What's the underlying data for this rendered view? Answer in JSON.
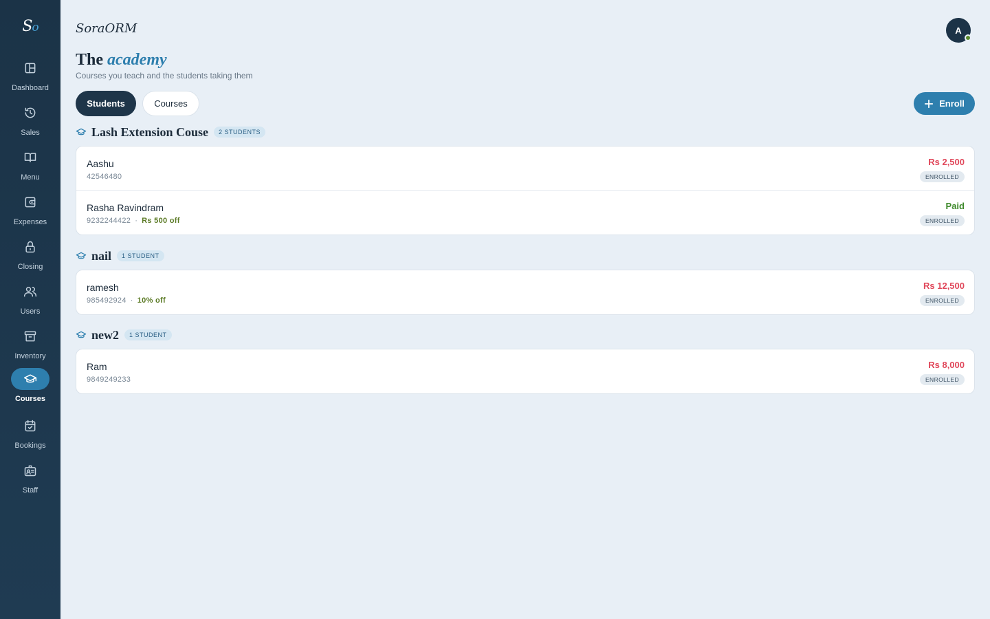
{
  "app": {
    "logo_main": "S",
    "logo_accent": "o",
    "brand": "SoraORM",
    "avatar_initial": "A"
  },
  "sidebar": {
    "items": [
      {
        "label": "Dashboard",
        "icon": "dashboard-icon"
      },
      {
        "label": "Sales",
        "icon": "history-icon"
      },
      {
        "label": "Menu",
        "icon": "book-icon"
      },
      {
        "label": "Expenses",
        "icon": "wallet-icon"
      },
      {
        "label": "Closing",
        "icon": "lock-icon"
      },
      {
        "label": "Users",
        "icon": "users-icon"
      },
      {
        "label": "Inventory",
        "icon": "archive-icon"
      },
      {
        "label": "Courses",
        "icon": "graduation-cap-icon",
        "active": true
      },
      {
        "label": "Bookings",
        "icon": "calendar-check-icon"
      },
      {
        "label": "Staff",
        "icon": "id-badge-icon"
      }
    ]
  },
  "header": {
    "title_plain": "The",
    "title_accent": "academy",
    "subtitle": "Courses you teach and the students taking them"
  },
  "tabs": {
    "students": "Students",
    "courses": "Courses"
  },
  "actions": {
    "enroll": "Enroll"
  },
  "courses": [
    {
      "name": "Lash Extension Couse",
      "count": "2 STUDENTS",
      "students": [
        {
          "name": "Aashu",
          "phone": "42546480",
          "amount": "Rs 2,500",
          "status": "ENROLLED"
        },
        {
          "name": "Rasha Ravindram",
          "phone": "9232244422",
          "discount": "Rs 500 off",
          "amount": "Paid",
          "status": "ENROLLED"
        }
      ]
    },
    {
      "name": "nail",
      "count": "1 STUDENT",
      "students": [
        {
          "name": "ramesh",
          "phone": "985492924",
          "discount": "10% off",
          "amount": "Rs 12,500",
          "status": "ENROLLED"
        }
      ]
    },
    {
      "name": "new2",
      "count": "1 STUDENT",
      "students": [
        {
          "name": "Ram",
          "phone": "9849249233",
          "amount": "Rs 8,000",
          "status": "ENROLLED"
        }
      ]
    }
  ],
  "colors": {
    "accent": "#2e7fae",
    "sidebar": "#1b3347",
    "due": "#e0475a",
    "paid": "#3f8a2c",
    "discount": "#5b7a25"
  }
}
